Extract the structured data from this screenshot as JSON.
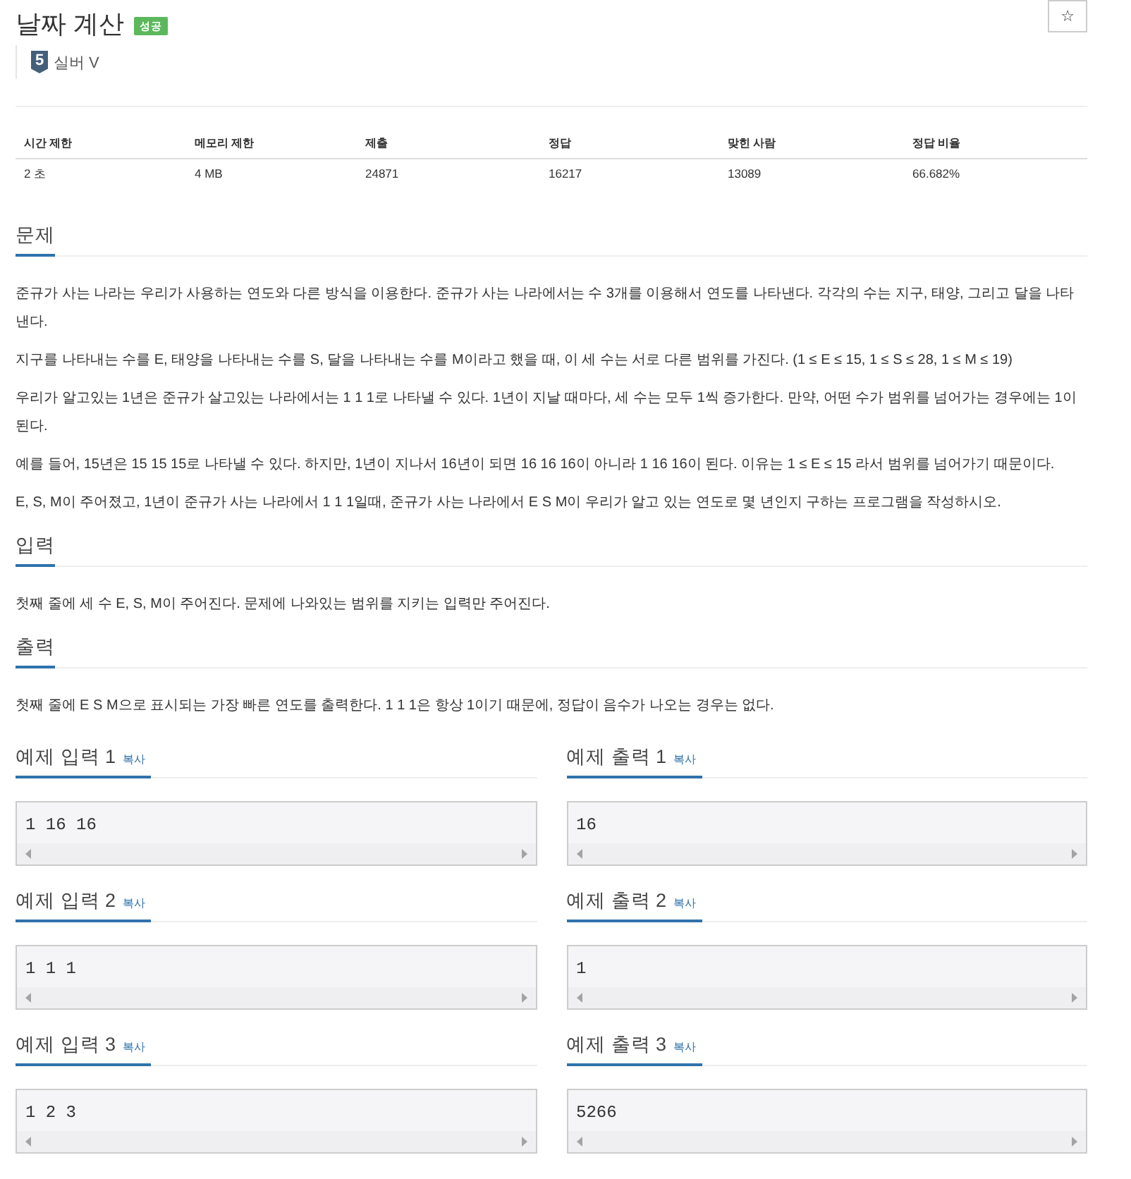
{
  "title": "날짜 계산",
  "result_badge": "성공",
  "star_button": "☆",
  "tier": {
    "badge": "5",
    "label": "실버 V"
  },
  "stats": {
    "columns": [
      "시간 제한",
      "메모리 제한",
      "제출",
      "정답",
      "맞힌 사람",
      "정답 비율"
    ],
    "rows": [
      [
        "2 초",
        "4 MB",
        "24871",
        "16217",
        "13089",
        "66.682%"
      ]
    ]
  },
  "sections": [
    {
      "heading": "문제",
      "paragraphs": [
        "준규가 사는 나라는 우리가 사용하는 연도와 다른 방식을 이용한다. 준규가 사는 나라에서는 수 3개를 이용해서 연도를 나타낸다. 각각의 수는 지구, 태양, 그리고 달을 나타낸다.",
        "지구를 나타내는 수를 E, 태양을 나타내는 수를 S, 달을 나타내는 수를 M이라고 했을 때, 이 세 수는 서로 다른 범위를 가진다. (1 ≤ E ≤ 15, 1 ≤ S ≤ 28, 1 ≤ M ≤ 19)",
        "우리가 알고있는 1년은 준규가 살고있는 나라에서는 1 1 1로 나타낼 수 있다. 1년이 지날 때마다, 세 수는 모두 1씩 증가한다. 만약, 어떤 수가 범위를 넘어가는 경우에는 1이 된다.",
        "예를 들어, 15년은 15 15 15로 나타낼 수 있다. 하지만, 1년이 지나서 16년이 되면 16 16 16이 아니라 1 16 16이 된다. 이유는 1 ≤ E ≤ 15 라서 범위를 넘어가기 때문이다.",
        "E, S, M이 주어졌고, 1년이 준규가 사는 나라에서 1 1 1일때, 준규가 사는 나라에서 E S M이 우리가 알고 있는 연도로 몇 년인지 구하는 프로그램을 작성하시오."
      ]
    },
    {
      "heading": "입력",
      "paragraphs": [
        "첫째 줄에 세 수 E, S, M이 주어진다. 문제에 나와있는 범위를 지키는 입력만 주어진다."
      ]
    },
    {
      "heading": "출력",
      "paragraphs": [
        "첫째 줄에 E S M으로 표시되는 가장 빠른 연도를 출력한다. 1 1 1은 항상 1이기 때문에, 정답이 음수가 나오는 경우는 없다."
      ]
    }
  ],
  "samples": [
    {
      "input": {
        "heading": "예제 입력 1",
        "copy": "복사",
        "text": "1 16 16"
      },
      "output": {
        "heading": "예제 출력 1",
        "copy": "복사",
        "text": "16"
      }
    },
    {
      "input": {
        "heading": "예제 입력 2",
        "copy": "복사",
        "text": "1 1 1"
      },
      "output": {
        "heading": "예제 출력 2",
        "copy": "복사",
        "text": "1"
      }
    },
    {
      "input": {
        "heading": "예제 입력 3",
        "copy": "복사",
        "text": "1 2 3"
      },
      "output": {
        "heading": "예제 출력 3",
        "copy": "복사",
        "text": "5266"
      }
    }
  ]
}
